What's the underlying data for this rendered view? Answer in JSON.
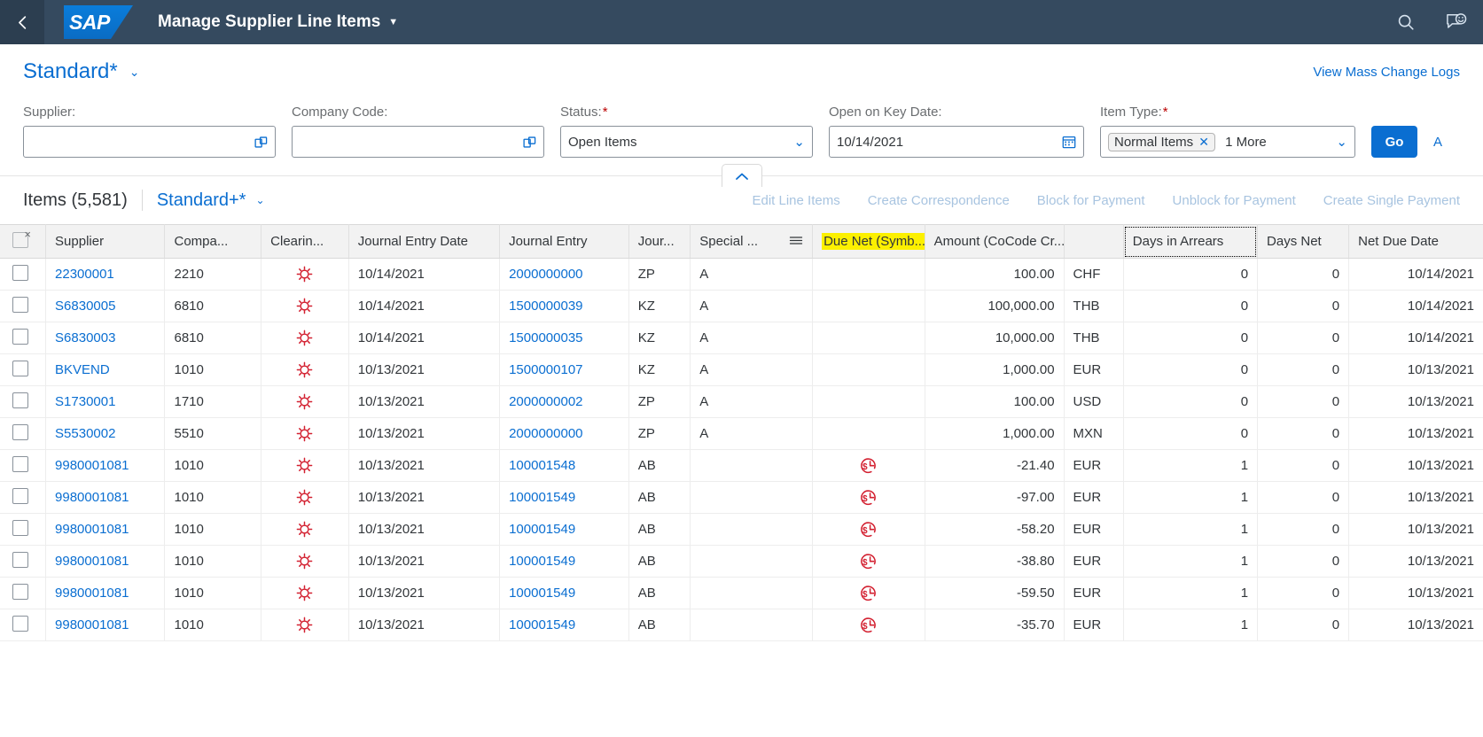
{
  "shell": {
    "back_icon": "chevron-left-icon",
    "logo_text": "SAP",
    "app_title": "Manage Supplier Line Items",
    "title_caret": "▼",
    "search_icon": "search-icon",
    "feedback_icon": "feedback-smiley-icon"
  },
  "variant": {
    "title": "Standard*",
    "caret": "⌄",
    "mass_change_link": "View Mass Change Logs"
  },
  "filters": {
    "supplier": {
      "label": "Supplier:",
      "value": "",
      "value_help_icon": "value-help-icon"
    },
    "company_code": {
      "label": "Company Code:",
      "value": "",
      "value_help_icon": "value-help-icon"
    },
    "status": {
      "label": "Status:",
      "required": "*",
      "value": "Open Items",
      "caret": "⌄"
    },
    "key_date": {
      "label": "Open on Key Date:",
      "value": "10/14/2021",
      "calendar_icon": "calendar-icon"
    },
    "item_type": {
      "label": "Item Type:",
      "required": "*",
      "token": "Normal Items",
      "token_remove": "✕",
      "more": "1 More",
      "caret": "⌄"
    },
    "go_label": "Go",
    "collapse_icon": "chevron-up-icon"
  },
  "toolbar": {
    "items_count": "Items (5,581)",
    "table_variant": "Standard+*",
    "variant_caret": "⌄",
    "actions": [
      "Edit Line Items",
      "Create Correspondence",
      "Block for Payment",
      "Unblock for Payment",
      "Create Single Payment"
    ]
  },
  "table": {
    "columns": [
      {
        "key": "check",
        "label": "",
        "cls": "c-check"
      },
      {
        "key": "sup",
        "label": "Supplier",
        "cls": "c-sup"
      },
      {
        "key": "cc",
        "label": "Compa...",
        "cls": "c-cc"
      },
      {
        "key": "clr",
        "label": "Clearin...",
        "cls": "c-clr"
      },
      {
        "key": "jed",
        "label": "Journal Entry Date",
        "cls": "c-jed"
      },
      {
        "key": "je",
        "label": "Journal Entry",
        "cls": "c-je"
      },
      {
        "key": "jet",
        "label": "Jour...",
        "cls": "c-jet"
      },
      {
        "key": "spec",
        "label": "Special ...",
        "cls": "c-spec"
      },
      {
        "key": "due",
        "label": "Due Net (Symb...",
        "cls": "c-due"
      },
      {
        "key": "amt",
        "label": "Amount (CoCode Cr...",
        "cls": "c-amt"
      },
      {
        "key": "cur",
        "label": "",
        "cls": "c-cur"
      },
      {
        "key": "arr",
        "label": "Days in Arrears",
        "cls": "c-arr"
      },
      {
        "key": "dnet",
        "label": "Days Net",
        "cls": "c-dnet"
      },
      {
        "key": "ndd",
        "label": "Net Due Date",
        "cls": "c-ndd"
      }
    ],
    "rows": [
      {
        "sup": "22300001",
        "cc": "2210",
        "clr": "open-item-icon",
        "jed": "10/14/2021",
        "je": "2000000000",
        "jet": "ZP",
        "spec": "A",
        "due": "",
        "amt": "100.00",
        "cur": "CHF",
        "arr": "0",
        "dnet": "0",
        "ndd": "10/14/2021"
      },
      {
        "sup": "S6830005",
        "cc": "6810",
        "clr": "open-item-icon",
        "jed": "10/14/2021",
        "je": "1500000039",
        "jet": "KZ",
        "spec": "A",
        "due": "",
        "amt": "100,000.00",
        "cur": "THB",
        "arr": "0",
        "dnet": "0",
        "ndd": "10/14/2021"
      },
      {
        "sup": "S6830003",
        "cc": "6810",
        "clr": "open-item-icon",
        "jed": "10/14/2021",
        "je": "1500000035",
        "jet": "KZ",
        "spec": "A",
        "due": "",
        "amt": "10,000.00",
        "cur": "THB",
        "arr": "0",
        "dnet": "0",
        "ndd": "10/14/2021"
      },
      {
        "sup": "BKVEND",
        "cc": "1010",
        "clr": "open-item-icon",
        "jed": "10/13/2021",
        "je": "1500000107",
        "jet": "KZ",
        "spec": "A",
        "due": "",
        "amt": "1,000.00",
        "cur": "EUR",
        "arr": "0",
        "dnet": "0",
        "ndd": "10/13/2021"
      },
      {
        "sup": "S1730001",
        "cc": "1710",
        "clr": "open-item-icon",
        "jed": "10/13/2021",
        "je": "2000000002",
        "jet": "ZP",
        "spec": "A",
        "due": "",
        "amt": "100.00",
        "cur": "USD",
        "arr": "0",
        "dnet": "0",
        "ndd": "10/13/2021"
      },
      {
        "sup": "S5530002",
        "cc": "5510",
        "clr": "open-item-icon",
        "jed": "10/13/2021",
        "je": "2000000000",
        "jet": "ZP",
        "spec": "A",
        "due": "",
        "amt": "1,000.00",
        "cur": "MXN",
        "arr": "0",
        "dnet": "0",
        "ndd": "10/13/2021"
      },
      {
        "sup": "9980001081",
        "cc": "1010",
        "clr": "open-item-icon",
        "jed": "10/13/2021",
        "je": "100001548",
        "jet": "AB",
        "spec": "",
        "due": "overdue-clock-icon",
        "amt": "-21.40",
        "cur": "EUR",
        "arr": "1",
        "dnet": "0",
        "ndd": "10/13/2021"
      },
      {
        "sup": "9980001081",
        "cc": "1010",
        "clr": "open-item-icon",
        "jed": "10/13/2021",
        "je": "100001549",
        "jet": "AB",
        "spec": "",
        "due": "overdue-clock-icon",
        "amt": "-97.00",
        "cur": "EUR",
        "arr": "1",
        "dnet": "0",
        "ndd": "10/13/2021"
      },
      {
        "sup": "9980001081",
        "cc": "1010",
        "clr": "open-item-icon",
        "jed": "10/13/2021",
        "je": "100001549",
        "jet": "AB",
        "spec": "",
        "due": "overdue-clock-icon",
        "amt": "-58.20",
        "cur": "EUR",
        "arr": "1",
        "dnet": "0",
        "ndd": "10/13/2021"
      },
      {
        "sup": "9980001081",
        "cc": "1010",
        "clr": "open-item-icon",
        "jed": "10/13/2021",
        "je": "100001549",
        "jet": "AB",
        "spec": "",
        "due": "overdue-clock-icon",
        "amt": "-38.80",
        "cur": "EUR",
        "arr": "1",
        "dnet": "0",
        "ndd": "10/13/2021"
      },
      {
        "sup": "9980001081",
        "cc": "1010",
        "clr": "open-item-icon",
        "jed": "10/13/2021",
        "je": "100001549",
        "jet": "AB",
        "spec": "",
        "due": "overdue-clock-icon",
        "amt": "-59.50",
        "cur": "EUR",
        "arr": "1",
        "dnet": "0",
        "ndd": "10/13/2021"
      },
      {
        "sup": "9980001081",
        "cc": "1010",
        "clr": "open-item-icon",
        "jed": "10/13/2021",
        "je": "100001549",
        "jet": "AB",
        "spec": "",
        "due": "overdue-clock-icon",
        "amt": "-35.70",
        "cur": "EUR",
        "arr": "1",
        "dnet": "0",
        "ndd": "10/13/2021"
      }
    ],
    "highlighted_column_key": "due",
    "focused_column_key": "arr",
    "special_filter_icon": "filter-lines-icon"
  },
  "colors": {
    "shell_bg": "#354a5f",
    "accent": "#0a6ed1",
    "highlight": "#fcf000",
    "status_red": "#d32030",
    "required_red": "#bb0000"
  }
}
